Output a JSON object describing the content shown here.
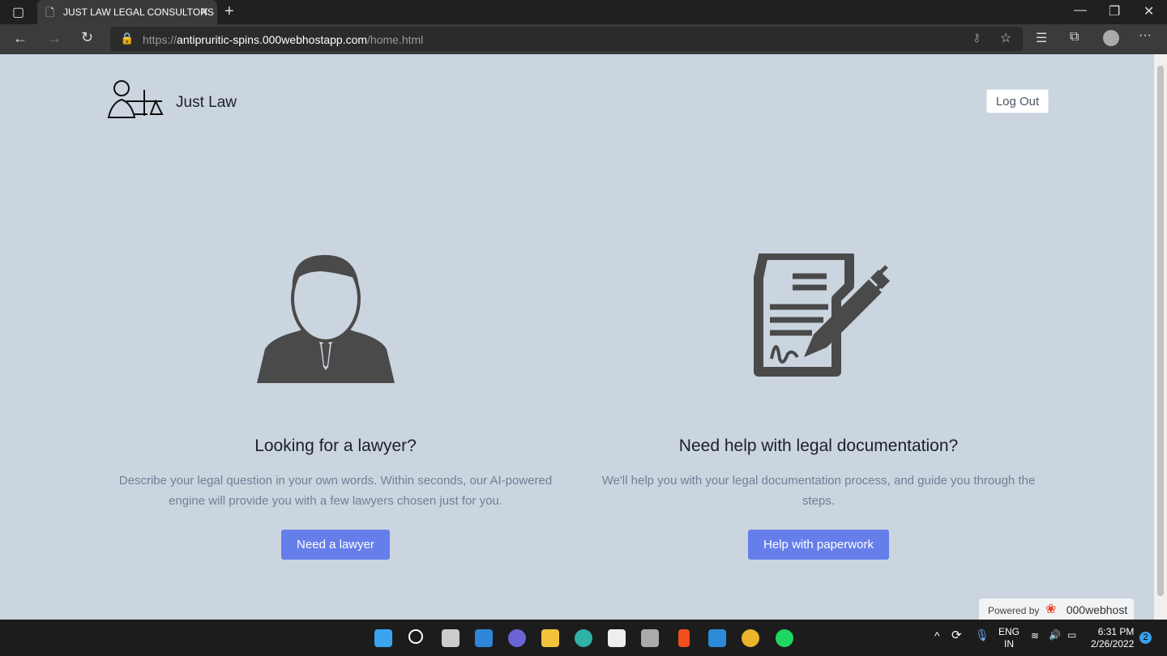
{
  "browser": {
    "tab_title": "JUST LAW LEGAL CONSULTORS",
    "url_scheme": "https://",
    "url_host": "antipruritic-spins.000webhostapp.com",
    "url_path": "/home.html"
  },
  "header": {
    "brand": "Just Law",
    "logout": "Log Out"
  },
  "cards": [
    {
      "icon": "lawyer-icon",
      "title": "Looking for a lawyer?",
      "text": "Describe your legal question in your own words. Within seconds, our AI-powered engine will provide you with a few lawyers chosen just for you.",
      "button": "Need a lawyer"
    },
    {
      "icon": "document-sign-icon",
      "title": "Need help with legal documentation?",
      "text": "We'll help you with your legal documentation process, and guide you through the steps.",
      "button": "Help with paperwork"
    }
  ],
  "badge": {
    "powered": "Powered by",
    "brand": "000webhost"
  },
  "taskbar": {
    "lang1": "ENG",
    "lang2": "IN",
    "time": "6:31 PM",
    "date": "2/26/2022",
    "notifications": "2"
  },
  "colors": {
    "page_bg": "#cbd5e0",
    "accent": "#667eea"
  }
}
